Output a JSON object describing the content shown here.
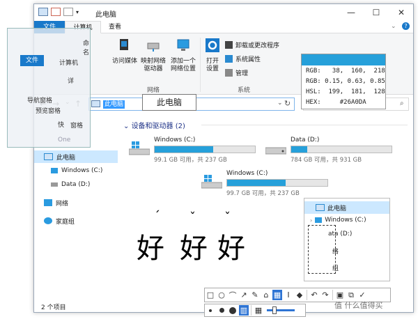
{
  "window": {
    "title": "此电脑",
    "controls": {
      "minimize": "—",
      "maximize": "☐",
      "close": "✕"
    }
  },
  "tabs": {
    "file": "文件",
    "computer": "计算机",
    "view": "查看"
  },
  "ribbon": {
    "access_media": "访问媒体",
    "map_drive_1": "映射网络",
    "map_drive_2": "驱动器",
    "add_location_1": "添加一个",
    "add_location_2": "网络位置",
    "open_settings_1": "打开",
    "open_settings_2": "设置",
    "uninstall": "卸载或更改程序",
    "system_props": "系统属性",
    "manage": "管理",
    "group_network": "网络",
    "group_system": "系统"
  },
  "address": {
    "location": "此电脑",
    "search_placeholder": ""
  },
  "tooltip": "此电脑",
  "color_picker": {
    "swatch": "#26A0DA",
    "rgb": "RGB:   38,  160,  218",
    "rgb_float": "RGB: 0.15, 0.63, 0.85",
    "hsl": "HSL:  199,  181,  128",
    "hex": "HEX:     #26A0DA"
  },
  "sidebar": {
    "this_pc": "此电脑",
    "windows_c": "Windows (C:)",
    "data_d": "Data (D:)",
    "network": "网络",
    "homegroup": "家庭组"
  },
  "ghost_panel": {
    "file_tab": "文件",
    "computer_tab": "计算机",
    "nav_pane": "导航窗格",
    "preview_pane": "预览窗格",
    "details": "详",
    "quick": "快",
    "onedrive": "One",
    "ribbon_label": "窗格",
    "rename": "命名"
  },
  "section": {
    "title": "设备和驱动器 (2)"
  },
  "drives": [
    {
      "name": "Windows (C:)",
      "info": "99.1 GB 可用，共 237 GB",
      "used_fraction": 0.58
    },
    {
      "name": "Data (D:)",
      "info": "784 GB 可用，共 931 GB",
      "used_fraction": 0.16
    },
    {
      "name": "Windows (C:)",
      "info": "99.7 GB 可用，共 237 GB",
      "used_fraction": 0.58
    }
  ],
  "tree_popup": {
    "this_pc": "此电脑",
    "windows_c": "Windows (C:)",
    "data_d": "ata (D:)",
    "item3": "络",
    "item4": "组"
  },
  "handwriting": {
    "char": "好",
    "tone1": "ˊ",
    "tone2": "ˇ",
    "tone3": "ˇ"
  },
  "status_bar": {
    "count": "2 个项目"
  },
  "watermark": "值 什么值得买",
  "colors": {
    "accent": "#1979ca",
    "drive_fill": "#26a0da",
    "selection": "#cce8ff"
  }
}
